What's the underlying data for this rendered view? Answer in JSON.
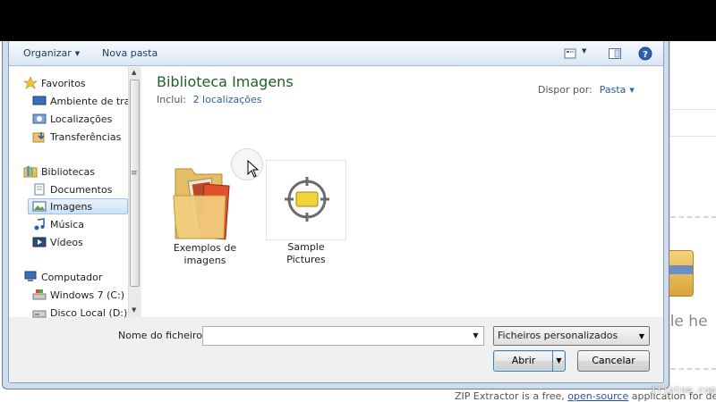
{
  "background": {
    "file_here_text": "file he",
    "footer_text_before": "ZIP Extractor is a free,",
    "footer_link": "open-source",
    "footer_text_after": "application for decom",
    "watermark": "itjotn≡.com"
  },
  "toolbar": {
    "organize_label": "Organizar",
    "new_folder_label": "Nova pasta"
  },
  "nav": {
    "favorites_label": "Favoritos",
    "favorites": [
      "Ambiente de trab",
      "Localizações",
      "Transferências"
    ],
    "libraries_label": "Bibliotecas",
    "libraries": [
      "Documentos",
      "Imagens",
      "Música",
      "Vídeos"
    ],
    "computer_label": "Computador",
    "drives": [
      "Windows 7 (C:)",
      "Disco Local (D:)"
    ]
  },
  "library": {
    "title": "Biblioteca Imagens",
    "includes_label": "Inclui:",
    "includes_link": "2 localizações",
    "arrange_label": "Dispor por:",
    "arrange_value": "Pasta"
  },
  "items": [
    {
      "label": "Exemplos de imagens"
    },
    {
      "label": "Sample Pictures"
    }
  ],
  "bottom": {
    "filename_label": "Nome do ficheiro:",
    "filename_value": "",
    "filter_value": "Ficheiros personalizados",
    "open_label": "Abrir",
    "cancel_label": "Cancelar"
  },
  "colors": {
    "library_title": "#1e5f2b",
    "link": "#2a5db0",
    "selection": "#cfe2f7"
  }
}
